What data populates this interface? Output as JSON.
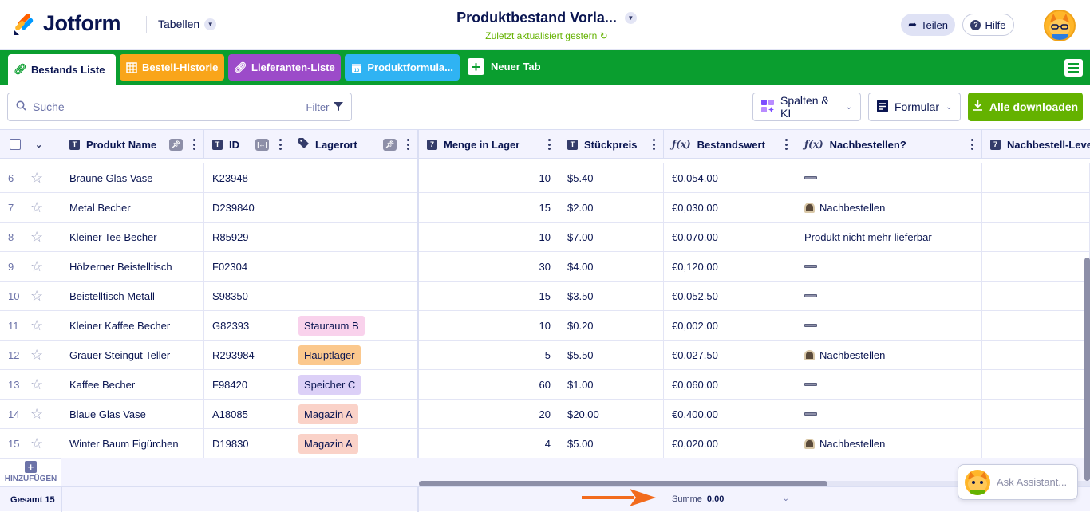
{
  "header": {
    "brand": "Jotform",
    "tables_menu": "Tabellen",
    "title": "Produktbestand Vorla...",
    "subtitle": "Zuletzt aktualisiert gestern",
    "share_label": "Teilen",
    "help_label": "Hilfe"
  },
  "tabs": [
    {
      "label": "Bestands Liste",
      "color": "#ffffff",
      "active": true
    },
    {
      "label": "Bestell-Historie",
      "color": "#f9a51a"
    },
    {
      "label": "Lieferanten-Liste",
      "color": "#9c4bc9"
    },
    {
      "label": "Produktformula...",
      "color": "#2fb3f3"
    }
  ],
  "new_tab_label": "Neuer Tab",
  "toolbar": {
    "search_placeholder": "Suche",
    "filter_label": "Filter",
    "columns_ai_label": "Spalten & KI",
    "form_label": "Formular",
    "download_label": "Alle downloaden"
  },
  "columns": [
    {
      "label": "Produkt Name",
      "type": "T"
    },
    {
      "label": "ID",
      "type": "T"
    },
    {
      "label": "Lagerort",
      "type": "tag"
    },
    {
      "label": "Menge in Lager",
      "type": "7"
    },
    {
      "label": "Stückpreis",
      "type": "T"
    },
    {
      "label": "Bestandswert",
      "type": "f(x)"
    },
    {
      "label": "Nachbestellen?",
      "type": "f(x)"
    },
    {
      "label": "Nachbestell-Level",
      "type": "7"
    }
  ],
  "rows": [
    {
      "n": "6",
      "name": "Braune Glas Vase",
      "id": "K23948",
      "loc": "",
      "qty": "10",
      "price": "$5.40",
      "value": "€0,054.00",
      "reorder": "dash"
    },
    {
      "n": "7",
      "name": "Metal Becher",
      "id": "D239840",
      "loc": "",
      "qty": "15",
      "price": "$2.00",
      "value": "€0,030.00",
      "reorder": "Nachbestellen"
    },
    {
      "n": "8",
      "name": "Kleiner Tee Becher",
      "id": "R85929",
      "loc": "",
      "qty": "10",
      "price": "$7.00",
      "value": "€0,070.00",
      "reorder": "Produkt nicht mehr lieferbar"
    },
    {
      "n": "9",
      "name": "Hölzerner Beistelltisch",
      "id": "F02304",
      "loc": "",
      "qty": "30",
      "price": "$4.00",
      "value": "€0,120.00",
      "reorder": "dash"
    },
    {
      "n": "10",
      "name": "Beistelltisch Metall",
      "id": "S98350",
      "loc": "",
      "qty": "15",
      "price": "$3.50",
      "value": "€0,052.50",
      "reorder": "dash"
    },
    {
      "n": "11",
      "name": "Kleiner Kaffee Becher",
      "id": "G82393",
      "loc": "Stauraum B",
      "loc_color": "#f9d2ec",
      "qty": "10",
      "price": "$0.20",
      "value": "€0,002.00",
      "reorder": "dash"
    },
    {
      "n": "12",
      "name": "Grauer Steingut Teller",
      "id": "R293984",
      "loc": "Hauptlager",
      "loc_color": "#fbc88d",
      "qty": "5",
      "price": "$5.50",
      "value": "€0,027.50",
      "reorder": "Nachbestellen"
    },
    {
      "n": "13",
      "name": "Kaffee Becher",
      "id": "F98420",
      "loc": "Speicher C",
      "loc_color": "#dcd0f7",
      "qty": "60",
      "price": "$1.00",
      "value": "€0,060.00",
      "reorder": "dash"
    },
    {
      "n": "14",
      "name": "Blaue Glas Vase",
      "id": "A18085",
      "loc": "Magazin A",
      "loc_color": "#fad2c8",
      "qty": "20",
      "price": "$20.00",
      "value": "€0,400.00",
      "reorder": "dash"
    },
    {
      "n": "15",
      "name": "Winter Baum Figürchen",
      "id": "D19830",
      "loc": "Magazin A",
      "loc_color": "#fad2c8",
      "qty": "4",
      "price": "$5.00",
      "value": "€0,020.00",
      "reorder": "Nachbestellen"
    }
  ],
  "add_label": "HINZUFÜGEN",
  "footer": {
    "total_label": "Gesamt 15",
    "sum_label": "Summe",
    "sum_value": "0.00"
  },
  "assistant_label": "Ask Assistant...",
  "colors": {
    "tabbar": "#0a9e2f",
    "download": "#64b200",
    "arrow": "#f26b1d"
  }
}
